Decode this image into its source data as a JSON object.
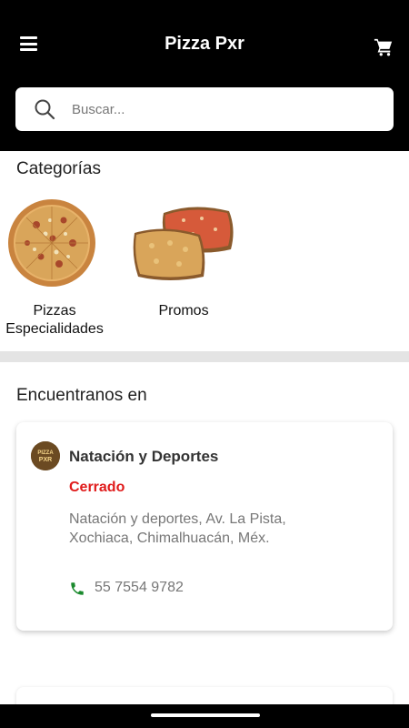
{
  "header": {
    "title": "Pizza Pxr",
    "menu_icon": "hamburger-menu-icon",
    "cart_icon": "shopping-cart-icon"
  },
  "search": {
    "placeholder": "Buscar...",
    "value": ""
  },
  "categories": {
    "title": "Categorías",
    "items": [
      {
        "label": "Pizzas Especialidades",
        "image": "whole-pizza-image"
      },
      {
        "label": "Promos",
        "image": "two-square-pizzas-image"
      }
    ]
  },
  "find_us": {
    "title": "Encuentranos en",
    "stores": [
      {
        "name": "Natación y Deportes",
        "status": "Cerrado",
        "address": "Natación y deportes, Av. La Pista, Xochiaca, Chimalhuacán, Méx.",
        "phone": "55 7554 9782",
        "logo_text": "PIZZA PXR"
      }
    ]
  },
  "colors": {
    "header_bg": "#000000",
    "status_closed": "#e01b1b",
    "phone_icon": "#1b8a2e",
    "divider": "#e4e4e4"
  }
}
